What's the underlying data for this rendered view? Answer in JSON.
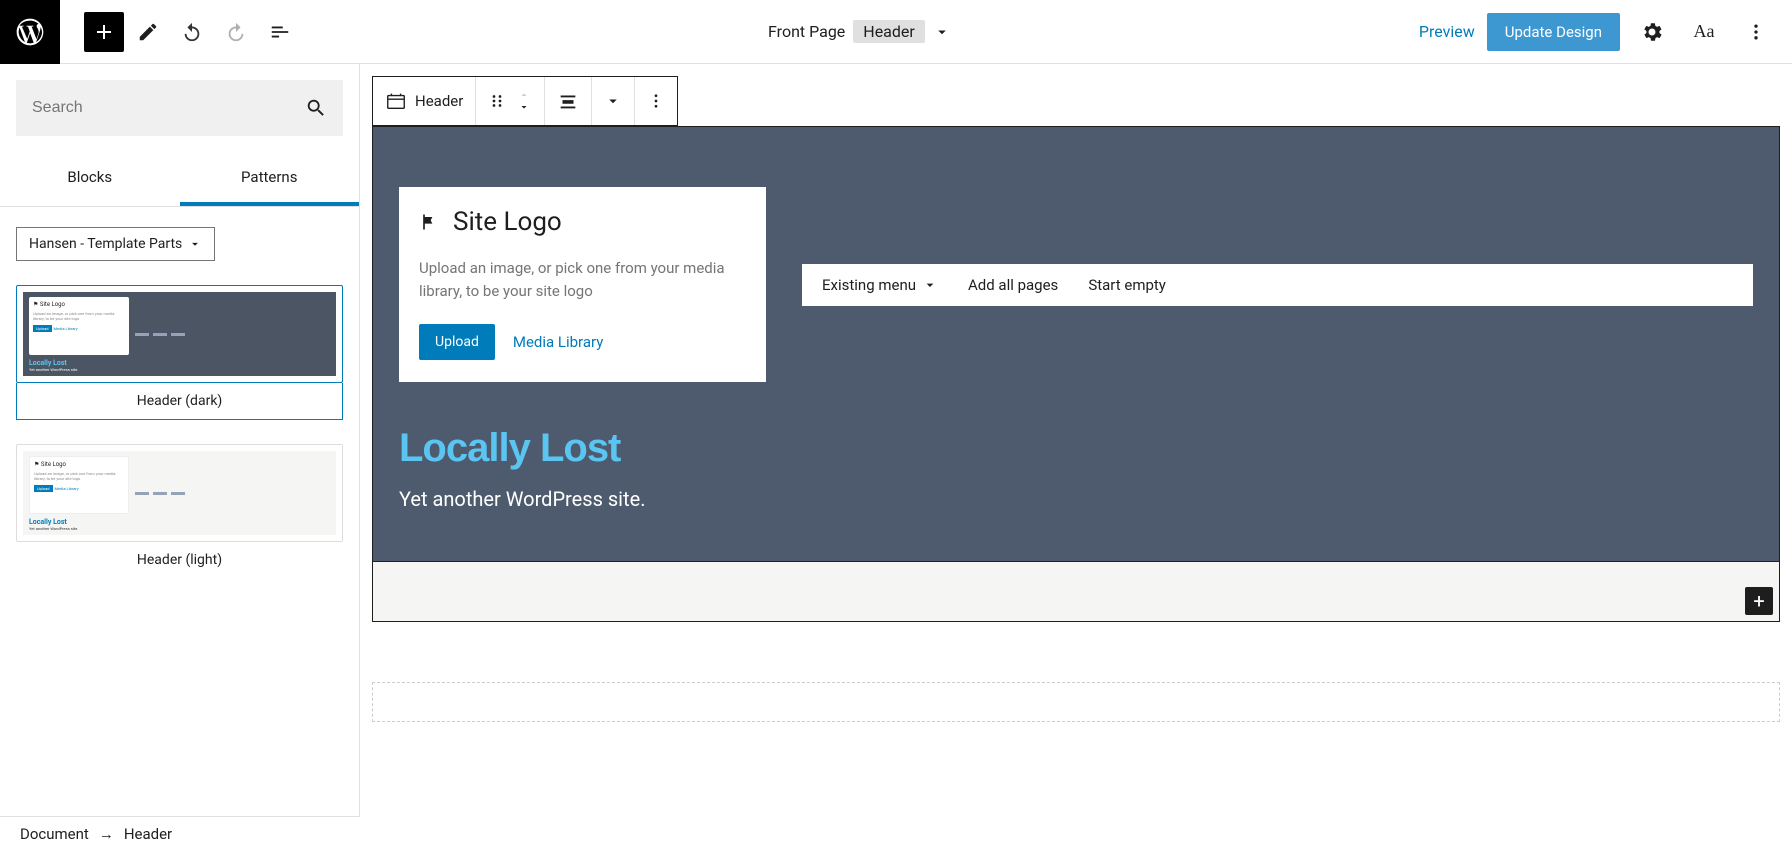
{
  "topbar": {
    "doc_label": "Front Page",
    "badge": "Header",
    "preview": "Preview",
    "update": "Update Design"
  },
  "sidebar": {
    "search_placeholder": "Search",
    "tabs": [
      "Blocks",
      "Patterns"
    ],
    "active_tab": 1,
    "dropdown": "Hansen - Template Parts",
    "patterns": [
      {
        "label": "Header (dark)",
        "thumb_title": "Locally Lost",
        "thumb_sub": "Yet another WordPress site.",
        "card_title": "Site Logo",
        "card_desc": "Upload an image, or pick one from your media library, to be your site logo",
        "card_btn": "Upload",
        "card_link": "Media Library"
      },
      {
        "label": "Header (light)",
        "thumb_title": "Locally Lost",
        "thumb_sub": "Yet another WordPress site.",
        "card_title": "Site Logo",
        "card_desc": "Upload an image, or pick one from your media library, to be your site logo",
        "card_btn": "Upload",
        "card_link": "Media Library"
      }
    ]
  },
  "block_toolbar": {
    "label": "Header"
  },
  "logo_card": {
    "title": "Site Logo",
    "desc": "Upload an image, or pick one from your media library, to be your site logo",
    "upload": "Upload",
    "media": "Media Library"
  },
  "nav": {
    "existing": "Existing menu",
    "add_all": "Add all pages",
    "start_empty": "Start empty"
  },
  "site": {
    "title": "Locally Lost",
    "tagline": "Yet another WordPress site."
  },
  "breadcrumb": {
    "doc": "Document",
    "current": "Header"
  }
}
